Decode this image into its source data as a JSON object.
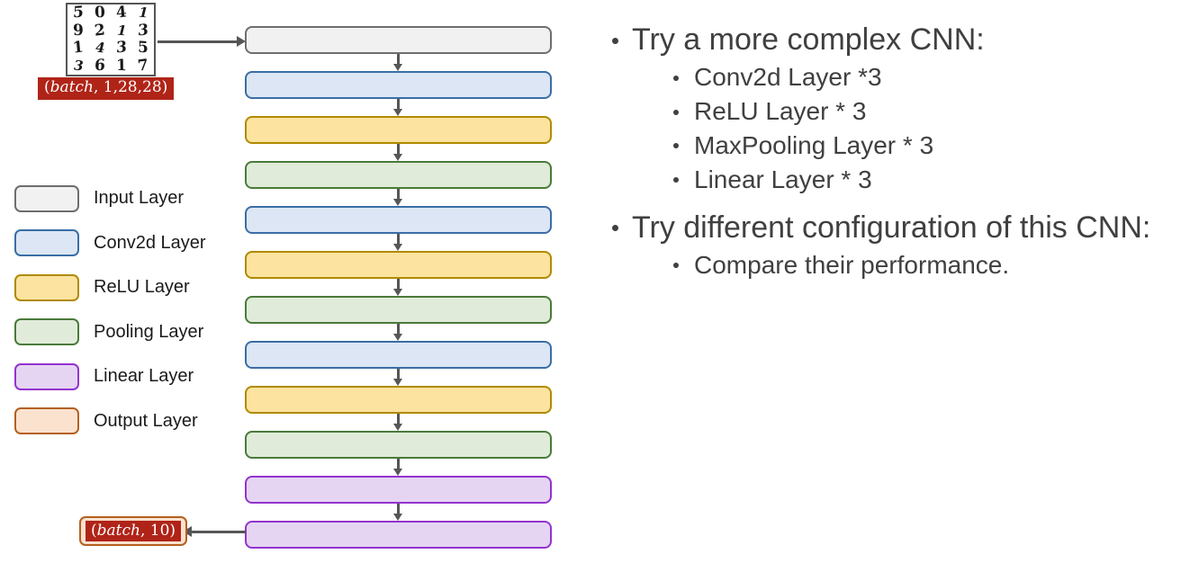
{
  "slide": {
    "title_hidden": "",
    "background": "#ffffff",
    "text_color": "#404040"
  },
  "mnist_sample": {
    "name": "mnist-digit-grid",
    "rows": [
      [
        "5",
        "0",
        "4",
        "1"
      ],
      [
        "9",
        "2",
        "1",
        "3"
      ],
      [
        "1",
        "4",
        "3",
        "5"
      ],
      [
        "3",
        "6",
        "1",
        "7"
      ]
    ]
  },
  "labels": {
    "input_shape_italic": "batch",
    "input_shape_rest": ", 1,28,28)",
    "input_shape_open": "(",
    "input_shape_full": "(batch, 1,28,28)",
    "output_shape_italic": "batch",
    "output_shape_rest": ", 10)",
    "output_shape_open": "(",
    "output_shape_full": "(batch, 10)",
    "label_bg": "#b02418",
    "output_box_bg": "#fbe2cf",
    "output_box_border": "#b4601f"
  },
  "legend": {
    "items": [
      {
        "label": "Input Layer",
        "fill": "#f1f1f1",
        "border": "#6e6e6e"
      },
      {
        "label": "Conv2d Layer",
        "fill": "#dce6f4",
        "border": "#3a6ea5"
      },
      {
        "label": "ReLU Layer",
        "fill": "#fce3a0",
        "border": "#b08a00"
      },
      {
        "label": "Pooling Layer",
        "fill": "#e0ecd9",
        "border": "#4a7a3a"
      },
      {
        "label": "Linear Layer",
        "fill": "#e5d5f2",
        "border": "#9333cf"
      },
      {
        "label": "Output Layer",
        "fill": "#fbe2cf",
        "border": "#b4601f"
      }
    ]
  },
  "flow": {
    "arrow_color": "#565656",
    "boxes": [
      {
        "type": "Input Layer",
        "fill": "#f1f1f1",
        "border": "#6e6e6e"
      },
      {
        "type": "Conv2d Layer",
        "fill": "#dce6f4",
        "border": "#3a6ea5"
      },
      {
        "type": "ReLU Layer",
        "fill": "#fce3a0",
        "border": "#b08a00"
      },
      {
        "type": "Pooling Layer",
        "fill": "#e0ecd9",
        "border": "#4a7a3a"
      },
      {
        "type": "Conv2d Layer",
        "fill": "#dce6f4",
        "border": "#3a6ea5"
      },
      {
        "type": "ReLU Layer",
        "fill": "#fce3a0",
        "border": "#b08a00"
      },
      {
        "type": "Pooling Layer",
        "fill": "#e0ecd9",
        "border": "#4a7a3a"
      },
      {
        "type": "Conv2d Layer",
        "fill": "#dce6f4",
        "border": "#3a6ea5"
      },
      {
        "type": "ReLU Layer",
        "fill": "#fce3a0",
        "border": "#b08a00"
      },
      {
        "type": "Pooling Layer",
        "fill": "#e0ecd9",
        "border": "#4a7a3a"
      },
      {
        "type": "Linear Layer",
        "fill": "#e5d5f2",
        "border": "#9333cf"
      },
      {
        "type": "Linear Layer",
        "fill": "#e5d5f2",
        "border": "#9333cf"
      }
    ]
  },
  "bullets": {
    "group1": {
      "heading": "Try a more complex CNN:",
      "items": [
        "Conv2d Layer *3",
        "ReLU Layer * 3",
        "MaxPooling Layer * 3",
        "Linear Layer * 3"
      ]
    },
    "group2": {
      "heading": "Try different configuration of this CNN:",
      "items": [
        "Compare their performance."
      ]
    }
  }
}
